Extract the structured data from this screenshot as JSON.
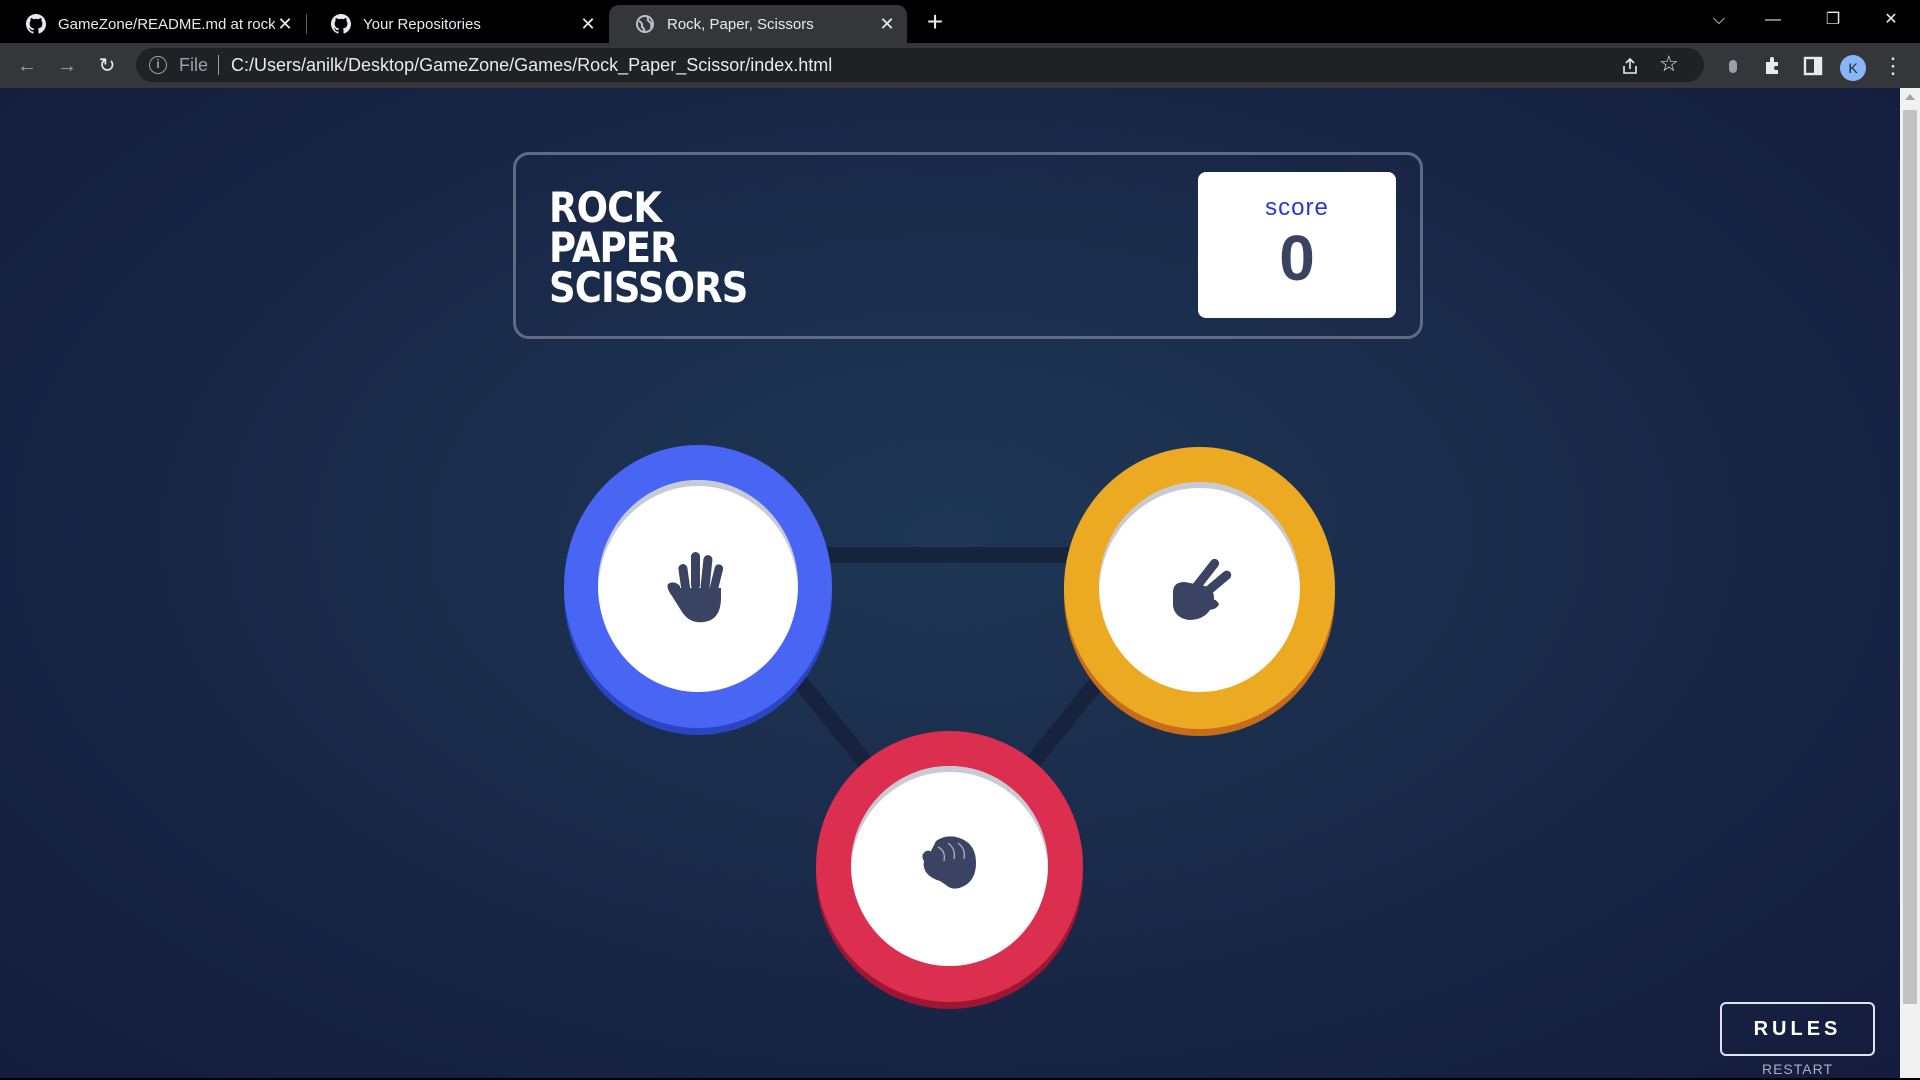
{
  "browser": {
    "tabs": [
      {
        "title": "GameZone/README.md at rock-",
        "icon": "github-icon"
      },
      {
        "title": "Your Repositories",
        "icon": "github-icon"
      },
      {
        "title": "Rock, Paper, Scissors",
        "icon": "globe-icon",
        "active": true
      }
    ],
    "address": {
      "protocol": "File",
      "url": "C:/Users/anilk/Desktop/GameZone/Games/Rock_Paper_Scissor/index.html"
    },
    "profile_initial": "K"
  },
  "game": {
    "title_lines": [
      "ROCK",
      "PAPER",
      "SCISSORS"
    ],
    "score_label": "score",
    "score_value": "0",
    "choices": [
      {
        "name": "paper",
        "color": "#4865f4"
      },
      {
        "name": "scissors",
        "color": "#eca922"
      },
      {
        "name": "rock",
        "color": "#dc2e4e"
      }
    ],
    "rules_label": "RULES",
    "restart_label": "RESTART"
  },
  "colors": {
    "background": "#192747",
    "hand": "#3b4363"
  }
}
